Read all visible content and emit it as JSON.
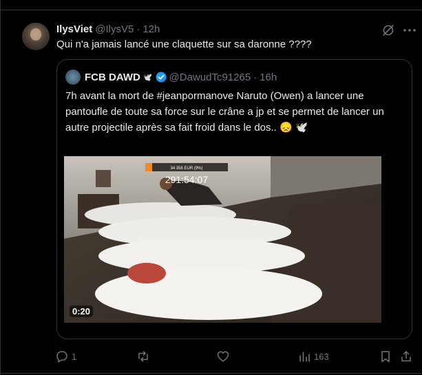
{
  "tweet": {
    "author_name": "IlysViet",
    "author_handle": "@IlysV5",
    "separator": "·",
    "time": "12h",
    "text": "Qui n'a jamais lancé une claquette sur sa daronne ????"
  },
  "quoted": {
    "author_name": "FCB DAWD",
    "author_emoji": "🕊️",
    "author_handle": "@DawudTc91265",
    "separator": "·",
    "time": "16h",
    "text": "7h avant la mort de #jeanpormanove Naruto (Owen) a lancer une pantoufle de toute sa force sur le crâne a jp et se permet de lancer un autre projectile après sa fait froid dans le dos.. 😞 🕊️",
    "video": {
      "duration": "0:20",
      "overlay_label": "SUB GOAL",
      "overlay_progress_text": "34 356 EUR (9%)",
      "timer": "291:54:07"
    }
  },
  "actions": {
    "reply_count": "1",
    "repost_count": "",
    "like_count": "",
    "view_count": "163"
  },
  "icons": {
    "grok": "grok-icon",
    "more": "more-icon",
    "verified": "verified-badge-icon",
    "reply": "reply-icon",
    "repost": "repost-icon",
    "like": "like-icon",
    "views": "views-icon",
    "bookmark": "bookmark-icon",
    "share": "share-icon"
  },
  "colors": {
    "background": "#000000",
    "text": "#e7e9ea",
    "muted": "#71767b",
    "border": "#2f3336",
    "verified": "#1d9bf0",
    "overlay_bar": "#f08a24"
  }
}
